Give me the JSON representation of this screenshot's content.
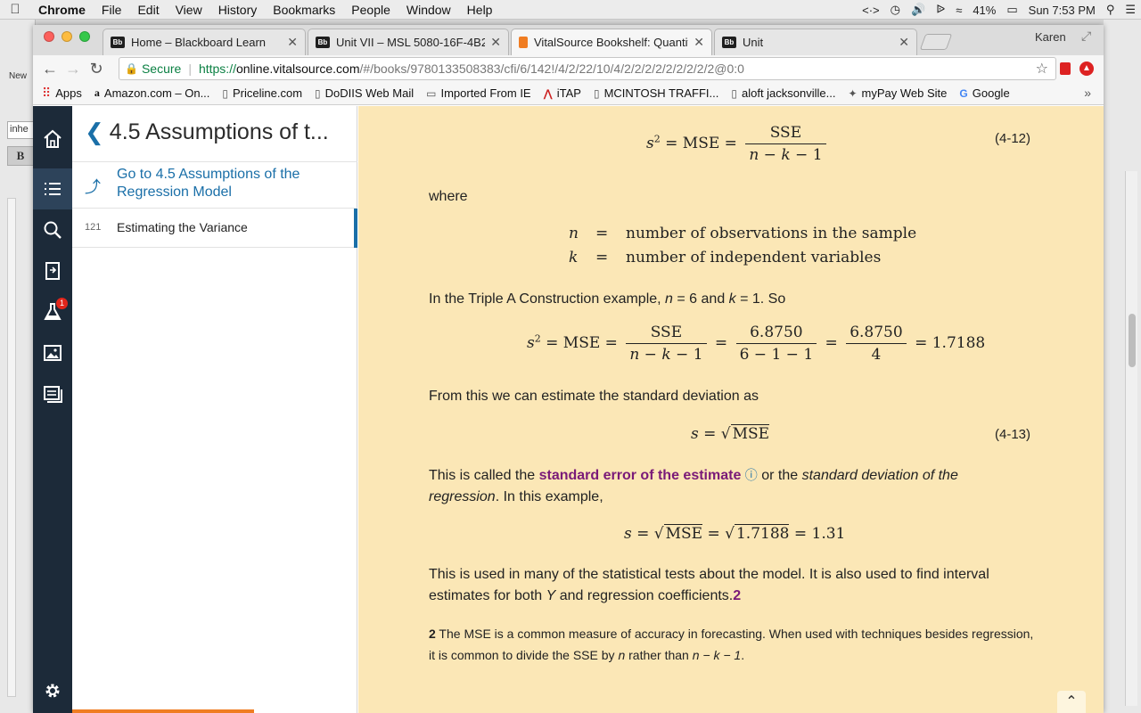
{
  "menubar": {
    "app": "Chrome",
    "items": [
      "File",
      "Edit",
      "View",
      "History",
      "Bookmarks",
      "People",
      "Window",
      "Help"
    ],
    "battery": "41%",
    "clock": "Sun 7:53 PM"
  },
  "background_app": {
    "new_label": "New",
    "field_text": "inhe",
    "bold_button": "B"
  },
  "tabs": [
    {
      "favicon": "Bb",
      "title": "Home – Blackboard Learn"
    },
    {
      "favicon": "Bb",
      "title": "Unit VII – MSL 5080-16F-4B2"
    },
    {
      "favicon": "",
      "title": "VitalSource Bookshelf: Quantit"
    },
    {
      "favicon": "Bb",
      "title": "Unit"
    }
  ],
  "profile": "Karen",
  "address": {
    "secure_label": "Secure",
    "scheme": "https://",
    "host": "online.vitalsource.com",
    "path": "/#/books/9780133508383/cfi/6/142!/4/2/22/10/4/2/2/2/2/2/2/2/2/2@0:0"
  },
  "bookmarks": [
    {
      "icon": "apps-grid-icon",
      "label": "Apps"
    },
    {
      "icon": "amazon-icon",
      "label": "Amazon.com – On..."
    },
    {
      "icon": "page-icon",
      "label": "Priceline.com"
    },
    {
      "icon": "page-icon",
      "label": "DoDIIS Web Mail"
    },
    {
      "icon": "folder-icon",
      "label": "Imported From IE"
    },
    {
      "icon": "itap-icon",
      "label": "iTAP"
    },
    {
      "icon": "page-icon",
      "label": "MCINTOSH TRAFFI..."
    },
    {
      "icon": "page-icon",
      "label": "aloft jacksonville..."
    },
    {
      "icon": "mypay-icon",
      "label": "myPay Web Site"
    },
    {
      "icon": "google-icon",
      "label": "Google"
    }
  ],
  "bookmarks_more": "»",
  "rail": {
    "badge_count": "1"
  },
  "toc": {
    "title": "4.5 Assumptions of t...",
    "goto_label": "Go to 4.5 Assumptions of the Regression Model",
    "entry_page": "121",
    "entry_label": "Estimating the Variance"
  },
  "content": {
    "eq12_number": "(4-12)",
    "where": "where",
    "defs": [
      {
        "sym": "n",
        "eq": "=",
        "desc": "number of observations in the sample"
      },
      {
        "sym": "k",
        "eq": "=",
        "desc": "number of independent variables"
      }
    ],
    "example_pre": "In the Triple A Construction example, ",
    "example_n": "n",
    "example_mid1": " = 6 and ",
    "example_k": "k",
    "example_post": " = 1. So",
    "calc": {
      "num1": "6.8750",
      "den1": "6 − 1 − 1",
      "num2": "6.8750",
      "den2": "4",
      "result": "= 1.7188"
    },
    "stddev_text": "From this we can estimate the standard deviation as",
    "eq13_number": "(4-13)",
    "called_pre": "This is called the ",
    "called_kw": "standard error of the estimate",
    "called_mid": " or the ",
    "called_em": "standard deviation of the regression",
    "called_post": ". In this example,",
    "s_calc": {
      "val": "1.7188",
      "result": "= 1.31"
    },
    "used_pre": "This is used in many of the statistical tests about the model. It is also used to find interval estimates for both ",
    "used_em": "Y",
    "used_post": " and regression coefficients.",
    "used_fn": "2",
    "footnote_num": "2",
    "footnote_pre": " The MSE is a common measure of accuracy in forecasting. When used with techniques besides regression, it is common to divide the SSE by ",
    "footnote_n": "n",
    "footnote_mid": " rather than ",
    "footnote_expr": "n − k − 1",
    "footnote_post": "."
  },
  "colors": {
    "reader_bg": "#fbe7b6",
    "rail_bg": "#1c2a39",
    "link": "#1a6fa8",
    "keyword": "#7a1a78",
    "progress": "#f07d22"
  }
}
